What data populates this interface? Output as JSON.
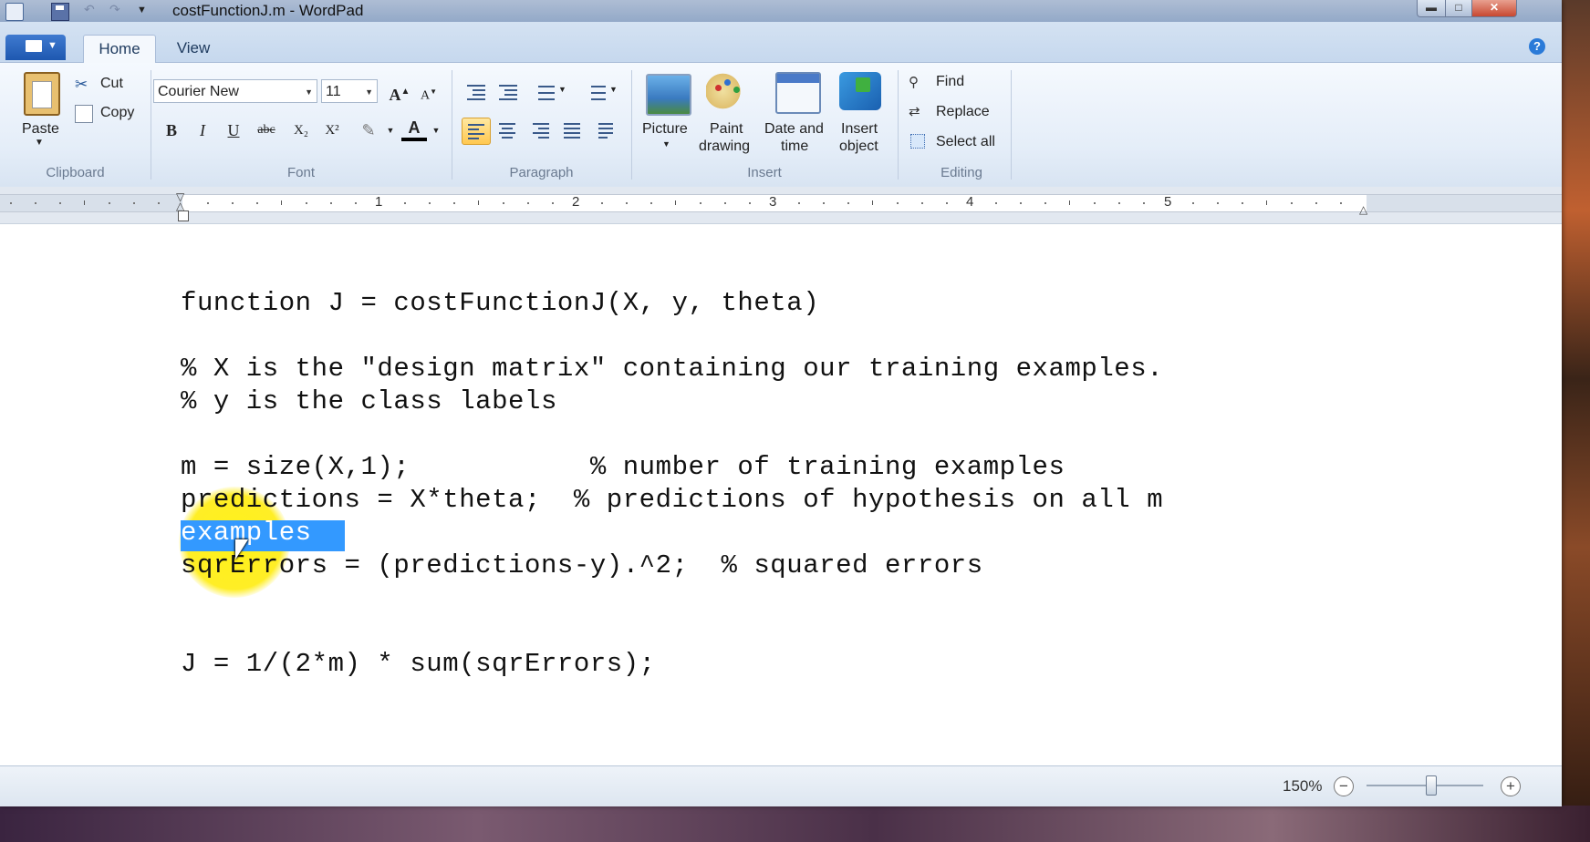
{
  "window": {
    "title": "costFunctionJ.m - WordPad"
  },
  "tabs": {
    "home": "Home",
    "view": "View"
  },
  "ribbon": {
    "clipboard": {
      "group_label": "Clipboard",
      "paste": "Paste",
      "cut": "Cut",
      "copy": "Copy"
    },
    "font": {
      "group_label": "Font",
      "font_name": "Courier New",
      "font_size": "11",
      "bold": "B",
      "italic": "I",
      "underline": "U",
      "strikethrough": "abc",
      "subscript": "X₂",
      "superscript": "X²",
      "font_color": "A",
      "grow": "A",
      "shrink": "A"
    },
    "paragraph": {
      "group_label": "Paragraph"
    },
    "insert": {
      "group_label": "Insert",
      "picture": "Picture",
      "paint_drawing_1": "Paint",
      "paint_drawing_2": "drawing",
      "date_time_1": "Date and",
      "date_time_2": "time",
      "insert_object_1": "Insert",
      "insert_object_2": "object"
    },
    "editing": {
      "group_label": "Editing",
      "find": "Find",
      "replace": "Replace",
      "select_all": "Select all"
    }
  },
  "ruler": {
    "numbers": [
      "1",
      "2",
      "3",
      "4",
      "5"
    ]
  },
  "document": {
    "lines": [
      "function J = costFunctionJ(X, y, theta)",
      "% X is the \"design matrix\" containing our training examples.",
      "% y is the class labels",
      "m = size(X,1);           % number of training examples",
      "predictions = X*theta;  % predictions of hypothesis on all m",
      "examples",
      "sqrErrors = (predictions-y).^2;  % squared errors",
      "J = 1/(2*m) * sum(sqrErrors);"
    ],
    "selected_text": "examples"
  },
  "statusbar": {
    "zoom": "150%"
  },
  "colors": {
    "selection": "#3399ff",
    "cursor_highlight": "#ffeb00",
    "ribbon_bg": "#e4edf8"
  }
}
